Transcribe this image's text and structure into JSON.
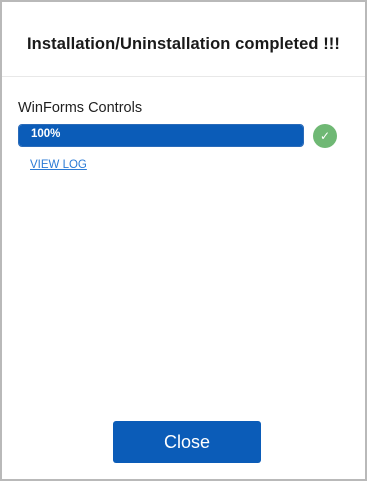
{
  "dialog": {
    "title": "Installation/Uninstallation completed !!!"
  },
  "items": [
    {
      "name": "WinForms Controls",
      "progress_text": "100%",
      "progress_fraction": 1.0,
      "status": "success",
      "status_icon": "checkmark-icon",
      "status_glyph": "✓",
      "status_color": "#6fb874",
      "view_log_label": "VIEW LOG"
    }
  ],
  "footer": {
    "close_label": "Close"
  },
  "colors": {
    "accent": "#0b5cb8",
    "link": "#2b7bd6",
    "success": "#6fb874"
  }
}
